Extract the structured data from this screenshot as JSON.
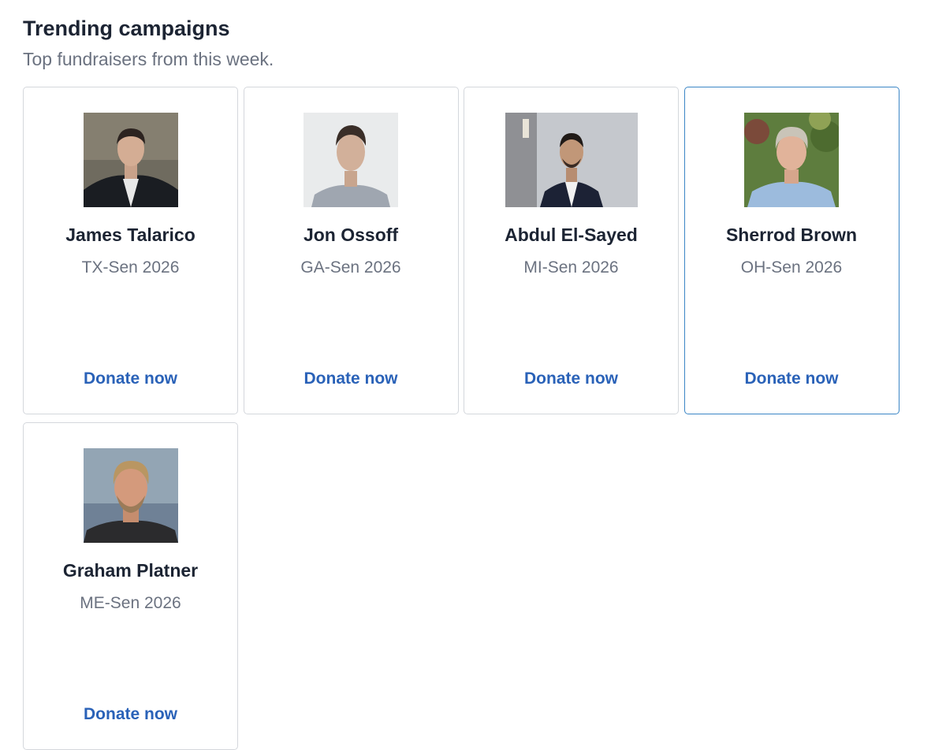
{
  "header": {
    "title": "Trending campaigns",
    "subtitle": "Top fundraisers from this week."
  },
  "campaigns": [
    {
      "name": "James Talarico",
      "race": "TX-Sen 2026",
      "cta": "Donate now",
      "active": false
    },
    {
      "name": "Jon Ossoff",
      "race": "GA-Sen 2026",
      "cta": "Donate now",
      "active": false
    },
    {
      "name": "Abdul El-Sayed",
      "race": "MI-Sen 2026",
      "cta": "Donate now",
      "active": false
    },
    {
      "name": "Sherrod Brown",
      "race": "OH-Sen 2026",
      "cta": "Donate now",
      "active": true
    },
    {
      "name": "Graham Platner",
      "race": "ME-Sen 2026",
      "cta": "Donate now",
      "active": false
    }
  ],
  "colors": {
    "title": "#1c2433",
    "muted": "#6b7280",
    "link": "#2a62b8",
    "card_border": "#d4d7dc",
    "card_border_active": "#3b86c6"
  }
}
